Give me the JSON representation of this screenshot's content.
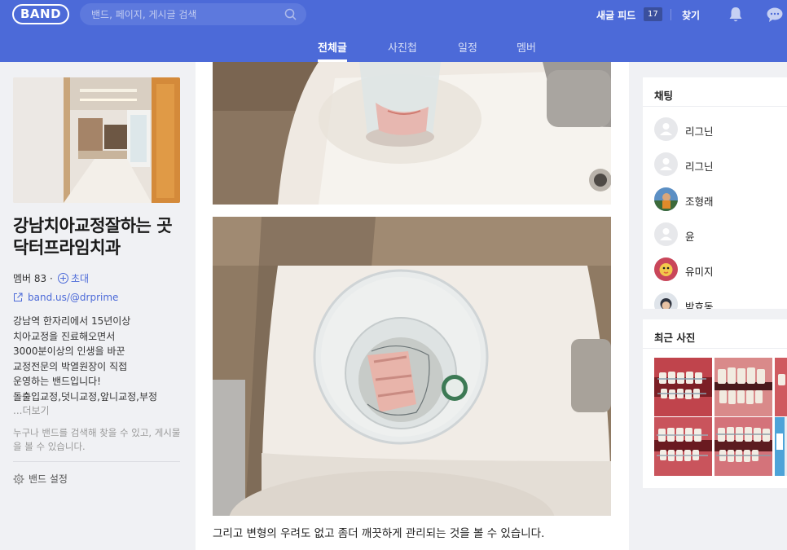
{
  "header": {
    "logo": "BAND",
    "search_placeholder": "밴드, 페이지, 게시글 검색",
    "new_feed_label": "새글 피드",
    "new_feed_count": "17",
    "find_label": "찾기"
  },
  "tabs": [
    {
      "label": "전체글",
      "active": true
    },
    {
      "label": "사진첩",
      "active": false
    },
    {
      "label": "일정",
      "active": false
    },
    {
      "label": "멤버",
      "active": false
    }
  ],
  "band": {
    "name": "강남치아교정잘하는 곳 닥터프라임치과",
    "members": "멤버 83 ·",
    "invite": "초대",
    "url": "band.us/@drprime",
    "description": [
      "강남역 한자리에서 15년이상",
      "치아교정을 진료해오면서",
      "3000분이상의 인생을 바꾼",
      "교정전문의 박열원장이 직접",
      "운영하는 밴드입니다!",
      "돌출입교정,덧니교정,앞니교정,부정"
    ],
    "more": "...더보기",
    "public_notice": "누구나 밴드를 검색해 찾을 수 있고, 게시물을 볼 수 있습니다.",
    "settings": "밴드 설정"
  },
  "post": {
    "caption": "그리고 변형의 우려도 없고 좀더 깨끗하게 관리되는 것을 볼 수 있습니다."
  },
  "chat": {
    "title": "채팅",
    "items": [
      {
        "name": "리그닌",
        "avatar": "default"
      },
      {
        "name": "리그닌",
        "avatar": "default"
      },
      {
        "name": "조형래",
        "avatar": "photo"
      },
      {
        "name": "윤",
        "avatar": "default"
      },
      {
        "name": "유미지",
        "avatar": "photo"
      },
      {
        "name": "박효동",
        "avatar": "photo"
      }
    ]
  },
  "recent_photos": {
    "title": "최근 사진"
  },
  "colors": {
    "brand": "#4c6ad8",
    "background": "#f0f1f4"
  }
}
